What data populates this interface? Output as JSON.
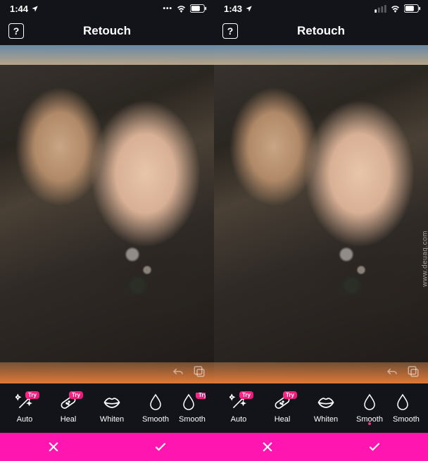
{
  "watermark": "www.deuaq.com",
  "phones": [
    {
      "status": {
        "time": "1:44",
        "location_arrow": true,
        "signal_strength": 3,
        "wifi": true,
        "battery": 70
      },
      "nav": {
        "title": "Retouch",
        "help": "?"
      },
      "canvas": {
        "undo_visible": true,
        "compare_visible": true
      },
      "tools": [
        {
          "id": "auto",
          "label": "Auto",
          "icon": "wand",
          "try": true,
          "active": false
        },
        {
          "id": "heal",
          "label": "Heal",
          "icon": "bandage",
          "try": true,
          "active": false
        },
        {
          "id": "whiten",
          "label": "Whiten",
          "icon": "lips",
          "try": false,
          "active": false
        },
        {
          "id": "smooth",
          "label": "Smooth",
          "icon": "drop",
          "try": false,
          "active": false
        },
        {
          "id": "smooth2",
          "label": "Smooth",
          "icon": "drop",
          "try": true,
          "active": false,
          "partial": true
        }
      ],
      "confirm": {
        "cancel": "✕",
        "apply": "✓"
      }
    },
    {
      "status": {
        "time": "1:43",
        "location_arrow": true,
        "signal_strength": 1,
        "wifi": true,
        "battery": 70
      },
      "nav": {
        "title": "Retouch",
        "help": "?"
      },
      "canvas": {
        "undo_visible": true,
        "compare_visible": true
      },
      "tools": [
        {
          "id": "auto",
          "label": "Auto",
          "icon": "wand",
          "try": true,
          "active": false
        },
        {
          "id": "heal",
          "label": "Heal",
          "icon": "bandage",
          "try": true,
          "active": false
        },
        {
          "id": "whiten",
          "label": "Whiten",
          "icon": "lips",
          "try": false,
          "active": false
        },
        {
          "id": "smooth",
          "label": "Smooth",
          "icon": "drop",
          "try": false,
          "active": true
        },
        {
          "id": "smooth2",
          "label": "Smooth",
          "icon": "drop",
          "try": false,
          "active": false,
          "partial": true
        }
      ],
      "confirm": {
        "cancel": "✕",
        "apply": "✓"
      }
    }
  ],
  "badge_label": "Try"
}
